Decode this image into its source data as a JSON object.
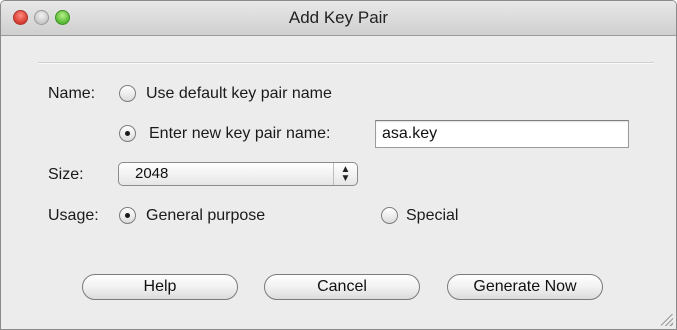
{
  "window": {
    "title": "Add Key Pair"
  },
  "form": {
    "name_label": "Name:",
    "name_options": [
      {
        "label": "Use default key pair name",
        "checked": false
      },
      {
        "label": "Enter new key pair name:",
        "checked": true
      }
    ],
    "key_name_value": "asa.key",
    "size_label": "Size:",
    "size_value": "2048",
    "usage_label": "Usage:",
    "usage_options": [
      {
        "label": "General purpose",
        "checked": true
      },
      {
        "label": "Special",
        "checked": false
      }
    ]
  },
  "buttons": {
    "help": "Help",
    "cancel": "Cancel",
    "generate": "Generate Now"
  },
  "icons": {
    "close": "close-traffic-light-icon",
    "minimize": "minimize-traffic-light-icon",
    "maximize": "maximize-traffic-light-icon",
    "select_arrows": "up-down-arrows-icon",
    "resize": "resize-grip-icon"
  },
  "colors": {
    "close": "#d63b2f",
    "maximize": "#55b934",
    "window_bg": "#ececec"
  }
}
